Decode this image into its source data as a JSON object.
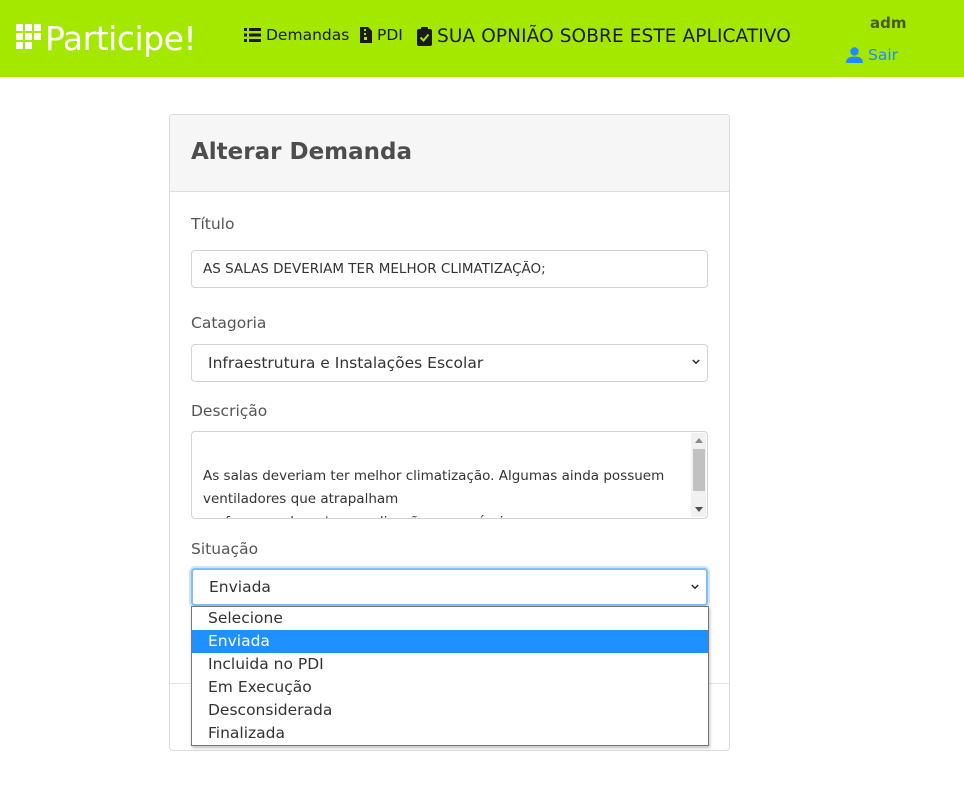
{
  "navbar": {
    "brand": "Participe!",
    "links": [
      {
        "label": "Demandas",
        "icon": "list-icon"
      },
      {
        "label": "PDI",
        "icon": "file-icon"
      },
      {
        "label": "SUA OPNIÃO SOBRE ESTE APLICATIVO",
        "icon": "clipboard-check-icon"
      }
    ],
    "user": "adm",
    "logout": "Sair",
    "colors": {
      "background": "#a4e800",
      "logout": "#1e8cff"
    }
  },
  "form": {
    "title": "Alterar Demanda",
    "titulo": {
      "label": "Título",
      "value": "AS SALAS DEVERIAM TER MELHOR CLIMATIZAÇÃO;"
    },
    "categoria": {
      "label": "Catagoria",
      "value": "Infraestrutura e Instalações Escolar"
    },
    "descricao": {
      "label": "Descrição",
      "value": "As salas deveriam ter melhor climatização. Algumas ainda possuem\nventiladores que atrapalham\nprofessores durante a explicação e os próprios\nalunos"
    },
    "situacao": {
      "label": "Situação",
      "value": "Enviada",
      "options": [
        "Selecione",
        "Enviada",
        "Incluida no PDI",
        "Em Execução",
        "Desconsiderada",
        "Finalizada"
      ],
      "selected_index": 1
    }
  }
}
